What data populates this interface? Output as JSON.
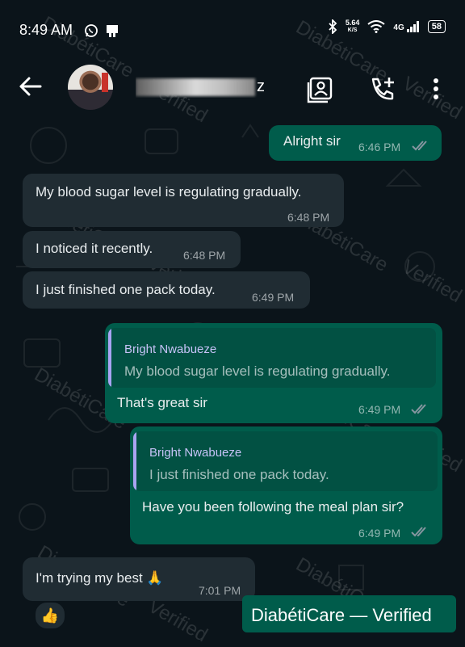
{
  "status_bar": {
    "time": "8:49 AM",
    "net_speed_value": "5.64",
    "net_speed_unit": "K/S",
    "network": "4G",
    "battery": "58"
  },
  "header": {
    "contact_name_visible_suffix": "ze",
    "icons": [
      "back-arrow-icon",
      "avatar",
      "contact-card-icon",
      "add-call-icon",
      "more-vert-icon"
    ]
  },
  "messages": [
    {
      "dir": "out",
      "text": "Alright sir",
      "time": "6:46 PM",
      "read": true
    },
    {
      "dir": "in",
      "text": "My blood sugar level is regulating  gradually.",
      "time": "6:48 PM"
    },
    {
      "dir": "in",
      "text": "I noticed it recently.",
      "time": "6:48 PM"
    },
    {
      "dir": "in",
      "text": "I just finished one pack today.",
      "time": "6:49 PM"
    },
    {
      "dir": "out",
      "quote_author": "Bright Nwabueze",
      "quote_text": "My blood sugar level is regulating  gradually.",
      "text": "That's great sir",
      "time": "6:49 PM",
      "read": true
    },
    {
      "dir": "out",
      "quote_author": "Bright Nwabueze",
      "quote_text": "I just finished one pack today.",
      "text": "Have you been following the meal plan sir?",
      "time": "6:49 PM",
      "read": true
    },
    {
      "dir": "in",
      "text": "I'm trying my best 🙏",
      "time": "7:01 PM",
      "reaction": "👍"
    }
  ],
  "watermark": {
    "text": "DiabétiCare",
    "overlay": "Verified",
    "badge": "DiabétiCare — Verified"
  },
  "colors": {
    "background": "#0b141a",
    "incoming_bubble": "#202c33",
    "outgoing_bubble": "#005c4b",
    "read_ticks": "#8696a0",
    "quote_bar": "#a9a4f2"
  }
}
